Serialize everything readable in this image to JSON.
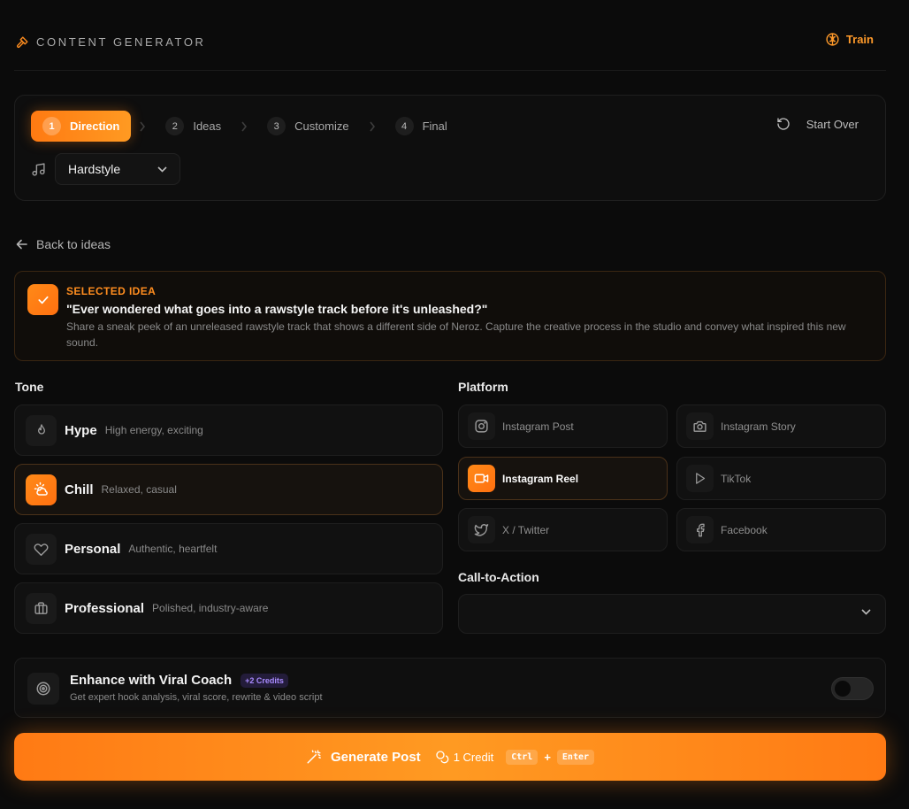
{
  "header": {
    "title": "CONTENT GENERATOR",
    "train_label": "Train"
  },
  "stepper": {
    "steps": [
      {
        "num": "1",
        "label": "Direction",
        "active": true
      },
      {
        "num": "2",
        "label": "Ideas"
      },
      {
        "num": "3",
        "label": "Customize"
      },
      {
        "num": "4",
        "label": "Final"
      }
    ],
    "start_over_label": "Start Over",
    "genre": "Hardstyle"
  },
  "back_label": "Back to ideas",
  "selected_idea": {
    "label": "SELECTED IDEA",
    "quote": "\"Ever wondered what goes into a rawstyle track before it's unleashed?\"",
    "description": "Share a sneak peek of an unreleased rawstyle track that shows a different side of Neroz. Capture the creative process in the studio and convey what inspired this new sound."
  },
  "tone": {
    "label": "Tone",
    "options": [
      {
        "name": "Hype",
        "sub": "High energy, exciting",
        "icon": "flame-icon"
      },
      {
        "name": "Chill",
        "sub": "Relaxed, casual",
        "icon": "sun-cloud-icon",
        "selected": true
      },
      {
        "name": "Personal",
        "sub": "Authentic, heartfelt",
        "icon": "heart-icon"
      },
      {
        "name": "Professional",
        "sub": "Polished, industry-aware",
        "icon": "briefcase-icon"
      }
    ]
  },
  "platform": {
    "label": "Platform",
    "options": [
      {
        "name": "Instagram Post",
        "icon": "instagram-icon"
      },
      {
        "name": "Instagram Story",
        "icon": "camera-icon"
      },
      {
        "name": "Instagram Reel",
        "icon": "video-icon",
        "selected": true
      },
      {
        "name": "TikTok",
        "icon": "play-icon"
      },
      {
        "name": "X / Twitter",
        "icon": "twitter-icon"
      },
      {
        "name": "Facebook",
        "icon": "facebook-icon"
      }
    ]
  },
  "cta": {
    "label": "Call-to-Action",
    "value": ""
  },
  "coach": {
    "title": "Enhance with Viral Coach",
    "badge": "+2 Credits",
    "sub": "Get expert hook analysis, viral score, rewrite & video script",
    "enabled": false
  },
  "generate": {
    "label": "Generate Post",
    "credit": "1 Credit",
    "key1": "Ctrl",
    "plus": "+",
    "key2": "Enter"
  },
  "colors": {
    "accent": "#ff8a18",
    "background": "#0b0b0b",
    "panel": "#111111",
    "badge": "#a98bff"
  }
}
